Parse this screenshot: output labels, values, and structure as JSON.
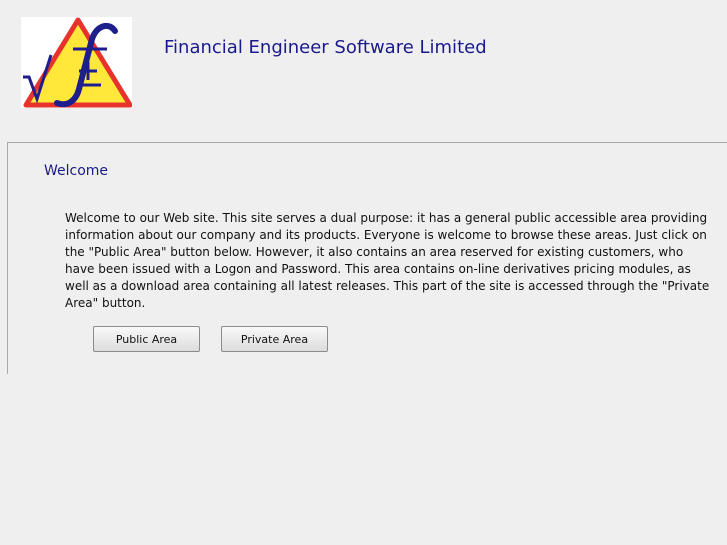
{
  "header": {
    "company_name": "Financial Engineer Software Limited",
    "logo": {
      "icon": "financial-engineer-logo-icon",
      "colors": {
        "triangle_fill": "#ffe83a",
        "triangle_border": "#e8322c",
        "symbols": "#1e1e8c"
      }
    }
  },
  "main": {
    "section_title": "Welcome",
    "intro_text": "Welcome to our Web site. This site serves a dual purpose: it has a general public accessible area providing information about our company and its products. Everyone is welcome to browse these areas. Just click on the \"Public Area\" button below. However, it also contains an area reserved for existing customers, who have been issued with a Logon and Password. This area contains on-line derivatives pricing modules, as well as a download area containing all latest releases. This part of the site is accessed through the \"Private Area\" button.",
    "buttons": {
      "public_label": "Public Area",
      "private_label": "Private Area"
    }
  },
  "colors": {
    "page_background": "#efefef",
    "heading_text": "#1a1a8c",
    "body_text": "#111111"
  }
}
